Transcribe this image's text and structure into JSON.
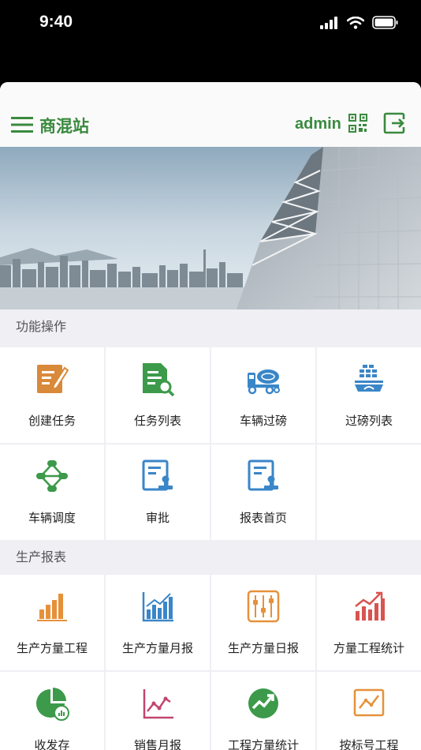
{
  "status": {
    "time": "9:40"
  },
  "header": {
    "title": "商混站",
    "user": "admin"
  },
  "sections": [
    {
      "title": "功能操作",
      "items": [
        {
          "label": "创建任务",
          "icon": "edit-document-icon",
          "color": "#d9893a"
        },
        {
          "label": "任务列表",
          "icon": "document-search-icon",
          "color": "#3c9a4a"
        },
        {
          "label": "车辆过磅",
          "icon": "mixer-truck-icon",
          "color": "#3a86c8"
        },
        {
          "label": "过磅列表",
          "icon": "scale-list-icon",
          "color": "#3a86c8"
        },
        {
          "label": "车辆调度",
          "icon": "dispatch-network-icon",
          "color": "#3c9a4a"
        },
        {
          "label": "审批",
          "icon": "approval-stamp-icon",
          "color": "#3a86c8"
        },
        {
          "label": "报表首页",
          "icon": "report-stamp-icon",
          "color": "#3a86c8"
        }
      ]
    },
    {
      "title": "生产报表",
      "items": [
        {
          "label": "生产方量工程",
          "icon": "bar-chart-icon",
          "color": "#e6913a"
        },
        {
          "label": "生产方量月报",
          "icon": "bar-trend-chart-icon",
          "color": "#3a86c8"
        },
        {
          "label": "生产方量日报",
          "icon": "sliders-icon",
          "color": "#e6913a"
        },
        {
          "label": "方量工程统计",
          "icon": "growth-chart-icon",
          "color": "#d9534f"
        },
        {
          "label": "收发存",
          "icon": "pie-chart-icon",
          "color": "#3c9a4a"
        },
        {
          "label": "销售月报",
          "icon": "line-chart-icon",
          "color": "#c2456e"
        },
        {
          "label": "工程方量统计",
          "icon": "trend-circle-icon",
          "color": "#3c9a4a"
        },
        {
          "label": "按标号工程",
          "icon": "framed-line-chart-icon",
          "color": "#e6913a"
        }
      ]
    }
  ]
}
